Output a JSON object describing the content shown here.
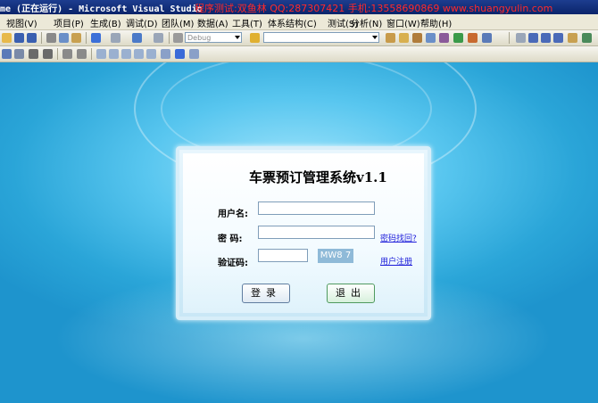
{
  "window": {
    "title": "me (正在运行) - Microsoft Visual Studio",
    "promo": "程序测试:双鱼林 QQ:287307421 手机:13558690869 www.shuangyulin.com"
  },
  "menu": [
    "视图(V)",
    "项目(P)",
    "生成(B)",
    "调试(D)",
    "团队(M)",
    "数据(A)",
    "工具(T)",
    "体系结构(C)",
    "测试(S)",
    "分析(N)",
    "窗口(W)",
    "帮助(H)"
  ],
  "toolbar": {
    "config_value": "Debug",
    "platform_value": "",
    "icons": [
      "open-icon",
      "save-icon",
      "save-all-icon",
      "cut-icon",
      "copy-icon",
      "paste-icon",
      "undo-icon",
      "redo-icon",
      "navigate-icon",
      "start-icon"
    ]
  },
  "login": {
    "title": "车票预订管理系统v1.1",
    "username_label": "用户名:",
    "username_value": "",
    "password_label": "密  码:",
    "password_value": "",
    "captcha_label": "验证码:",
    "captcha_value": "",
    "captcha_code": "MW8 7",
    "forgot_link": "密码找回?",
    "register_link": "用户注册",
    "login_button": "登录",
    "exit_button": "退出"
  },
  "colors": {
    "desktop": "#2aa5d8",
    "promo": "#ff2a2a",
    "link": "#1a1ad9"
  }
}
